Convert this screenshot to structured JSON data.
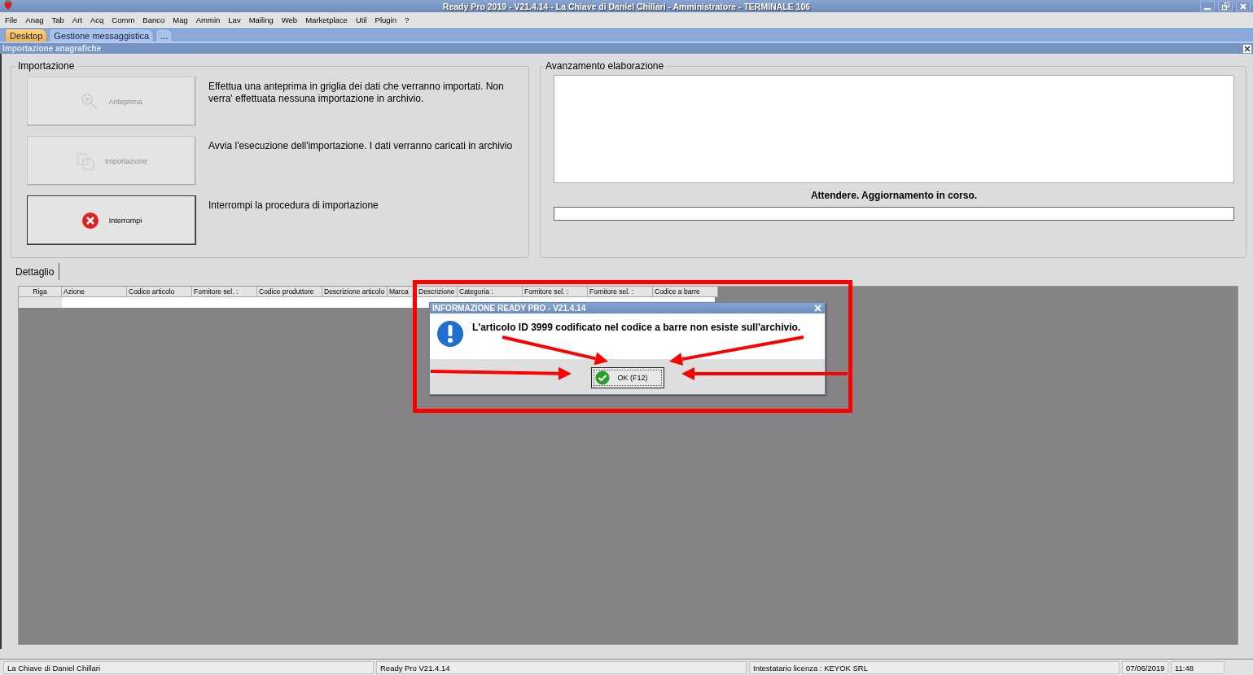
{
  "window": {
    "title": "Ready Pro 2019 - V21.4.14 - La Chiave di Daniel Chillari - Amministratore - TERMINALE 106"
  },
  "menu": [
    "File",
    "Anag",
    "Tab",
    "Art",
    "Acq",
    "Comm",
    "Banco",
    "Mag",
    "Ammin",
    "Lav",
    "Mailing",
    "Web",
    "Marketplace",
    "Util",
    "Plugin",
    "?"
  ],
  "tabs": [
    {
      "label": "Desktop",
      "selected": true
    },
    {
      "label": "Gestione messaggistica",
      "selected": false
    },
    {
      "label": "...",
      "selected": false
    }
  ],
  "form": {
    "title": "Importazione anagrafiche"
  },
  "import_group": {
    "title": "Importazione",
    "actions": [
      {
        "kind": "preview",
        "button": "Anteprima",
        "disabled": true,
        "description": "Effettua una anteprima in griglia dei dati che verranno importati. Non verra' effettuata nessuna importazione in archivio."
      },
      {
        "kind": "import",
        "button": "Importazione",
        "disabled": true,
        "description": "Avvia l'esecuzione dell'importazione. I dati verranno caricati in archivio"
      },
      {
        "kind": "stop",
        "button": "Interrompi",
        "disabled": false,
        "description": "Interrompi la procedura di importazione"
      }
    ]
  },
  "progress_group": {
    "title": "Avanzamento elaborazione",
    "status": "Attendere. Aggiornamento in corso.",
    "level": 0
  },
  "detail_tab": {
    "label": "Dettaglio"
  },
  "grid": {
    "columns": [
      "Riga",
      "Azione",
      "Codice articolo",
      "Fornitore sel. :",
      "Codice produttore",
      "Descrizione articolo",
      "Marca",
      "Descrizione",
      "Categoria :",
      "Fornitore sel. :",
      "Fornitore sel. :",
      "Codice a barre"
    ]
  },
  "dialog": {
    "title": "INFORMAZIONE READY PRO - V21.4.14",
    "message": "L'articolo ID 3999 codificato nel codice a barre non esiste sull'archivio.",
    "button": "OK (F12)"
  },
  "status_bar": [
    "La Chiave di Daniel Chillari",
    "Ready Pro V21.4.14",
    "Intestatario licenza : KEYOK SRL",
    "07/06/2019",
    "11:48"
  ]
}
